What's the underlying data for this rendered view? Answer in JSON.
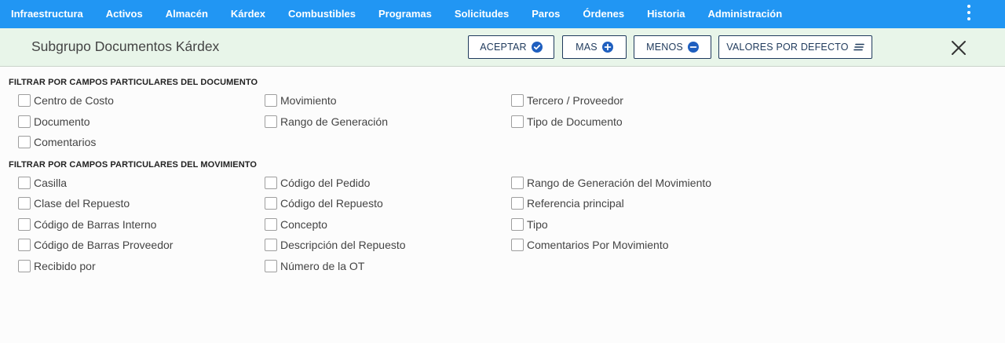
{
  "nav": {
    "items": [
      "Infraestructura",
      "Activos",
      "Almacén",
      "Kárdex",
      "Combustibles",
      "Programas",
      "Solicitudes",
      "Paros",
      "Órdenes",
      "Historia",
      "Administración"
    ],
    "menu_icon": "more-vert-icon"
  },
  "subheader": {
    "title": "Subgrupo Documentos Kárdex",
    "accept_label": "ACEPTAR",
    "accept_icon": "check-circle-icon",
    "more_label": "MAS",
    "more_icon": "plus-circle-icon",
    "less_label": "MENOS",
    "less_icon": "minus-circle-icon",
    "defaults_label": "VALORES POR DEFECTO",
    "defaults_icon": "lines-icon",
    "close_icon": "close-icon"
  },
  "document_filters": {
    "title": "FILTRAR POR CAMPOS PARTICULARES DEL DOCUMENTO",
    "options": [
      {
        "label": "Centro de Costo",
        "checked": false
      },
      {
        "label": "Movimiento",
        "checked": false
      },
      {
        "label": "Tercero / Proveedor",
        "checked": false
      },
      {
        "label": "Documento",
        "checked": false
      },
      {
        "label": "Rango de Generación",
        "checked": false
      },
      {
        "label": "Tipo de Documento",
        "checked": false
      },
      {
        "label": "Comentarios",
        "checked": false
      }
    ]
  },
  "movement_filters": {
    "title": "FILTRAR POR CAMPOS PARTICULARES DEL MOVIMIENTO",
    "options": [
      {
        "label": "Casilla",
        "checked": false
      },
      {
        "label": "Código del Pedido",
        "checked": false
      },
      {
        "label": "Rango de Generación del Movimiento",
        "checked": false
      },
      {
        "label": "Clase del Repuesto",
        "checked": false
      },
      {
        "label": "Código del Repuesto",
        "checked": false
      },
      {
        "label": "Referencia principal",
        "checked": false
      },
      {
        "label": "Código de Barras Interno",
        "checked": false
      },
      {
        "label": "Concepto",
        "checked": false
      },
      {
        "label": "Tipo",
        "checked": false
      },
      {
        "label": "Código de Barras Proveedor",
        "checked": false
      },
      {
        "label": "Descripción del Repuesto",
        "checked": false
      },
      {
        "label": "Comentarios Por Movimiento",
        "checked": false
      },
      {
        "label": "Recibido por",
        "checked": false
      },
      {
        "label": "Número de la OT",
        "checked": false
      }
    ]
  }
}
